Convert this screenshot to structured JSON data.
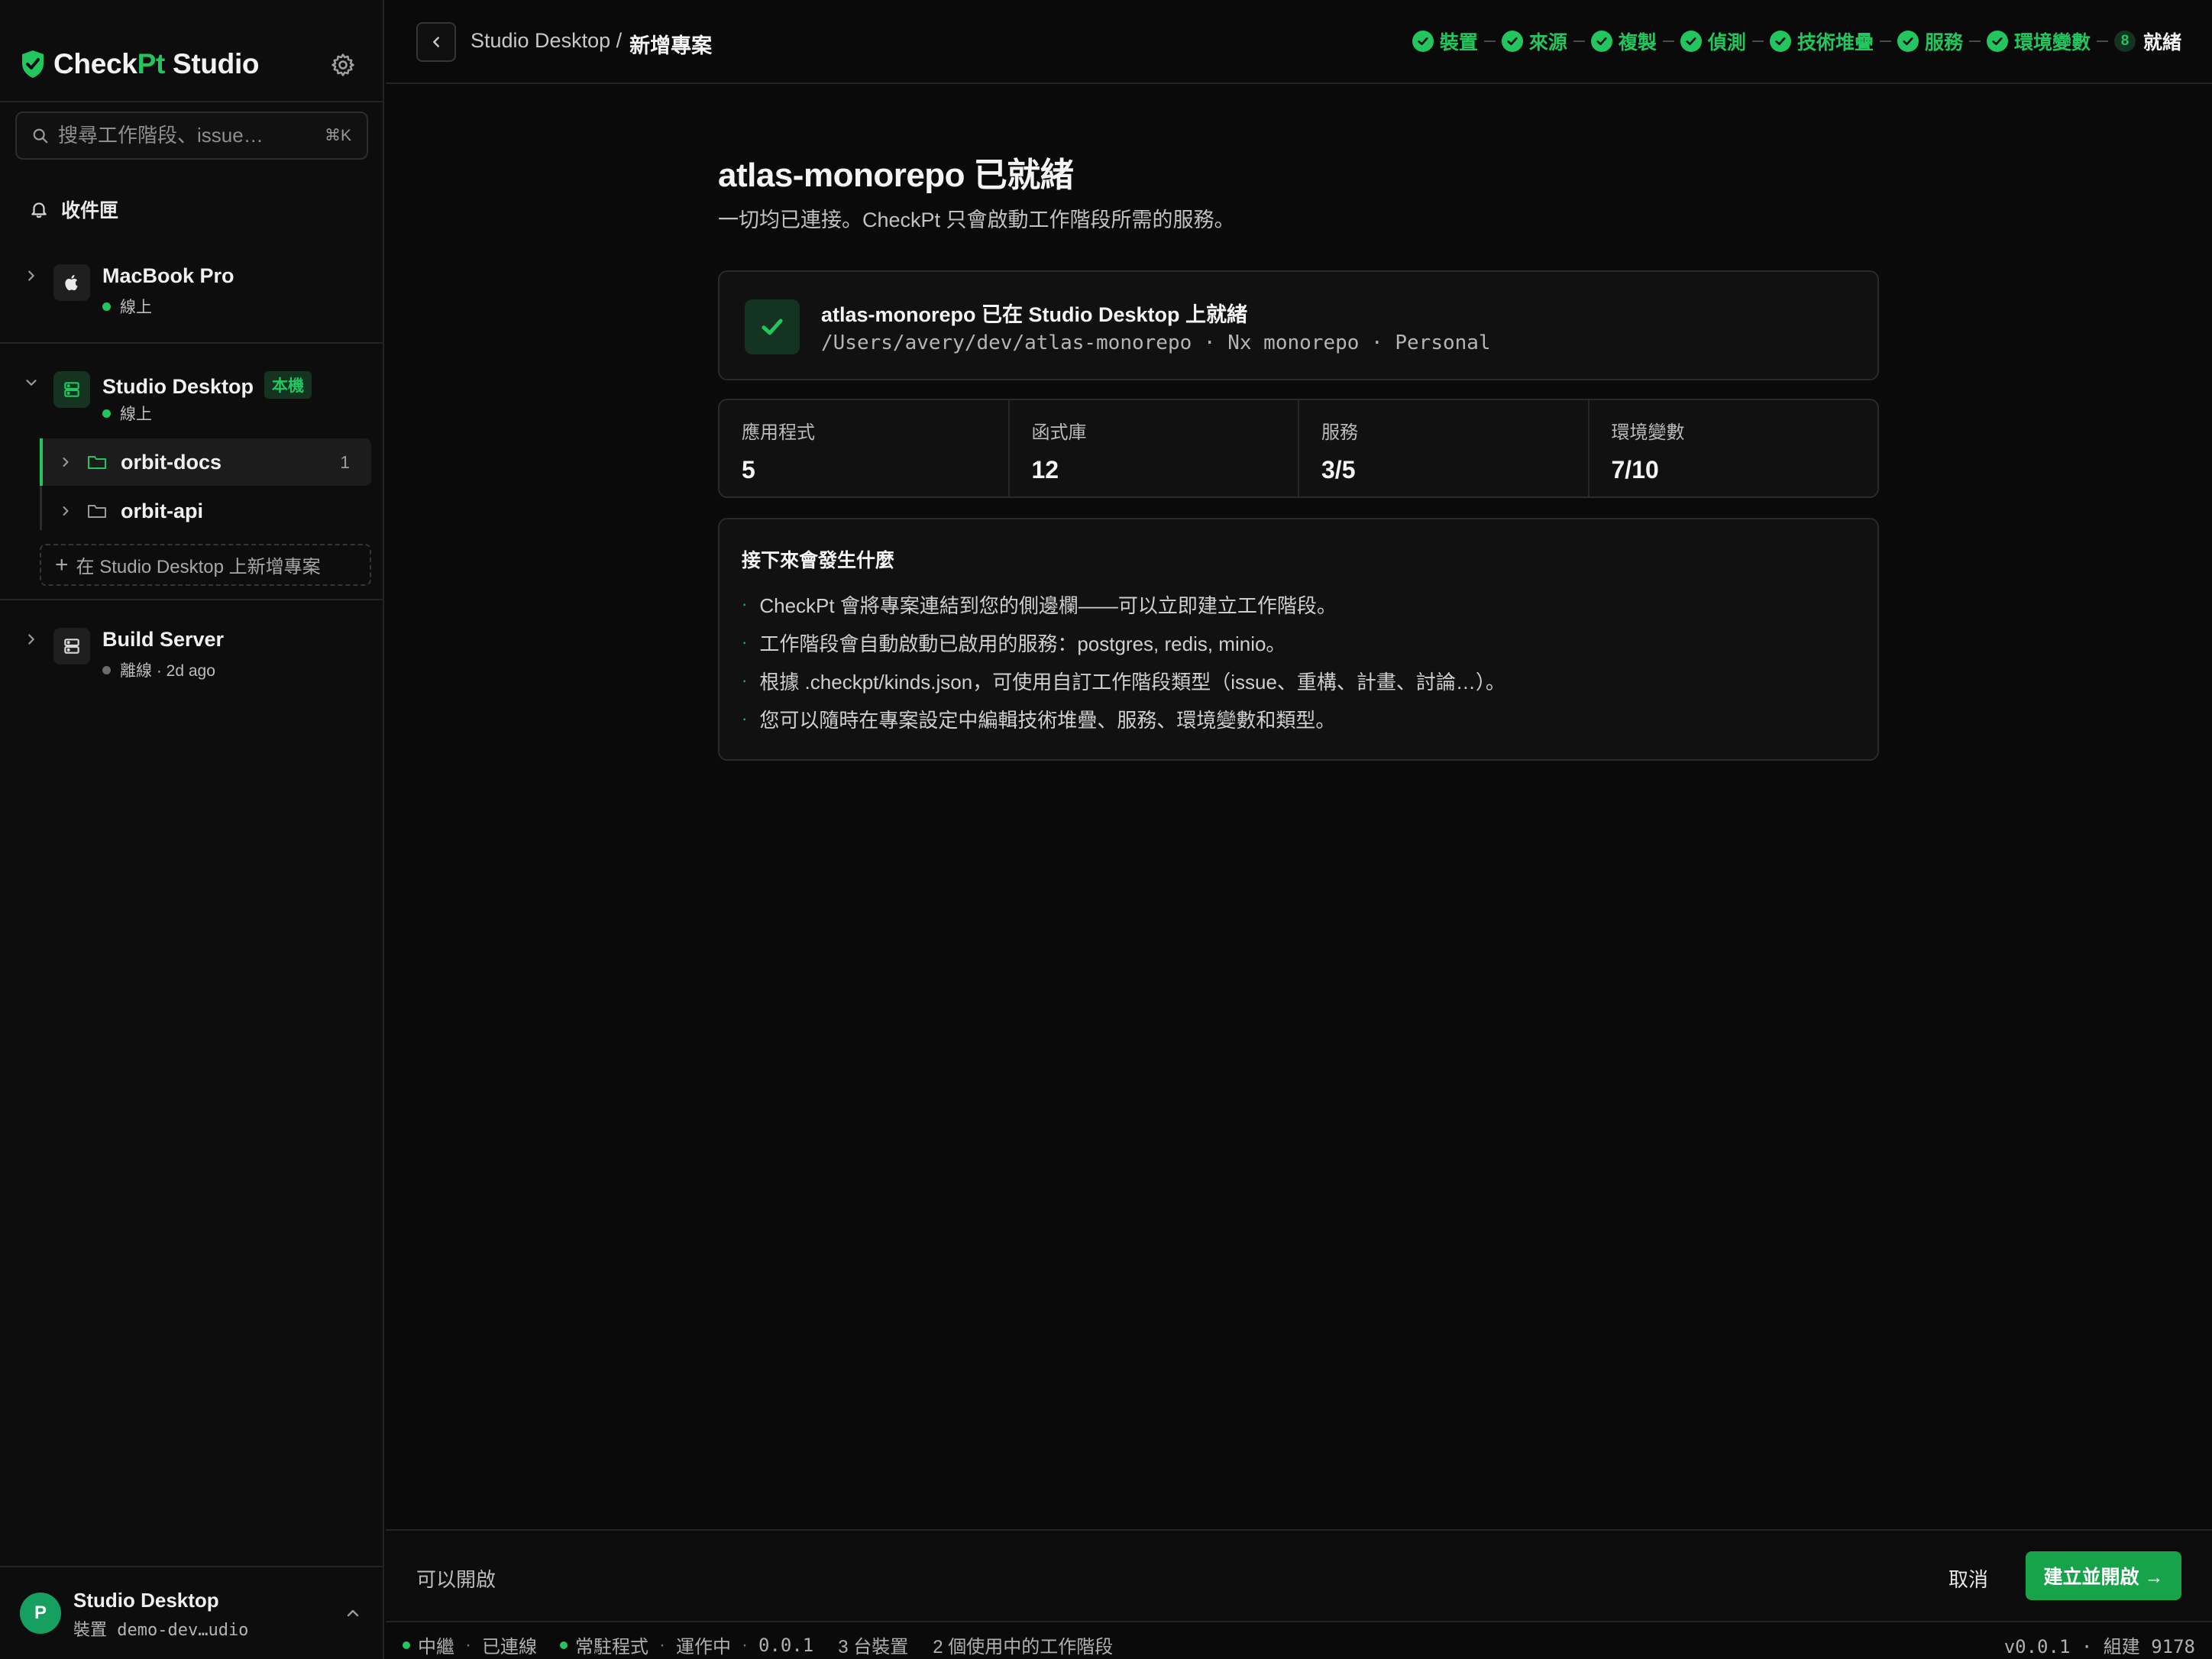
{
  "brand": {
    "name_prefix": "Check",
    "name_accent": "Pt",
    "name_suffix": " Studio"
  },
  "search": {
    "placeholder": "搜尋工作階段、issue…",
    "shortcut": "⌘K"
  },
  "inbox": {
    "label": "收件匣"
  },
  "devices": [
    {
      "name": "MacBook Pro",
      "status": "線上",
      "expanded": false
    },
    {
      "name": "Studio Desktop",
      "badge": "本機",
      "status": "線上",
      "expanded": true,
      "projects": [
        {
          "name": "orbit-docs",
          "count": "1",
          "active": true
        },
        {
          "name": "orbit-api",
          "count": "",
          "active": false
        }
      ],
      "add_project_label": "在 Studio Desktop 上新增專案"
    },
    {
      "name": "Build Server",
      "status": "離線 · 2d ago",
      "expanded": false
    }
  ],
  "account": {
    "initial": "P",
    "name": "Studio Desktop",
    "sub": "裝置 demo-dev…udio"
  },
  "breadcrumb": {
    "parent": "Studio Desktop /",
    "current": "新增專案"
  },
  "steps": [
    {
      "label": "裝置",
      "done": true
    },
    {
      "label": "來源",
      "done": true
    },
    {
      "label": "複製",
      "done": true
    },
    {
      "label": "偵測",
      "done": true
    },
    {
      "label": "技術堆疊",
      "done": true
    },
    {
      "label": "服務",
      "done": true
    },
    {
      "label": "環境變數",
      "done": true
    },
    {
      "label": "就緒",
      "done": false,
      "number": "8"
    }
  ],
  "main": {
    "title": "atlas-monorepo 已就緒",
    "subtitle": "一切均已連接。CheckPt 只會啟動工作階段所需的服務。",
    "ready_card": {
      "title": "atlas-monorepo 已在 Studio Desktop 上就緒",
      "path": "/Users/avery/dev/atlas-monorepo · Nx monorepo · Personal"
    },
    "stats": [
      {
        "label": "應用程式",
        "value": "5"
      },
      {
        "label": "函式庫",
        "value": "12"
      },
      {
        "label": "服務",
        "value": "3/5"
      },
      {
        "label": "環境變數",
        "value": "7/10"
      }
    ],
    "next": {
      "heading": "接下來會發生什麼",
      "items": [
        "CheckPt 會將專案連結到您的側邊欄——可以立即建立工作階段。",
        "工作階段會自動啟動已啟用的服務：postgres, redis, minio。",
        "根據 .checkpt/kinds.json，可使用自訂工作階段類型（issue、重構、計畫、討論…）。",
        "您可以隨時在專案設定中編輯技術堆疊、服務、環境變數和類型。"
      ]
    }
  },
  "actionbar": {
    "ready_label": "可以開啟",
    "cancel": "取消",
    "primary": "建立並開啟 →"
  },
  "statusbar": {
    "relay_label": "中繼",
    "relay_state": "已連線",
    "daemon_label": "常駐程式",
    "daemon_state": "運作中",
    "daemon_version": "0.0.1",
    "devices": "3 台裝置",
    "sessions": "2 個使用中的工作階段",
    "version": "v0.0.1 · 組建 9178"
  },
  "colors": {
    "accent": "#22c55e",
    "background": "#0a0a0a",
    "primary_button": "#16a34a"
  }
}
